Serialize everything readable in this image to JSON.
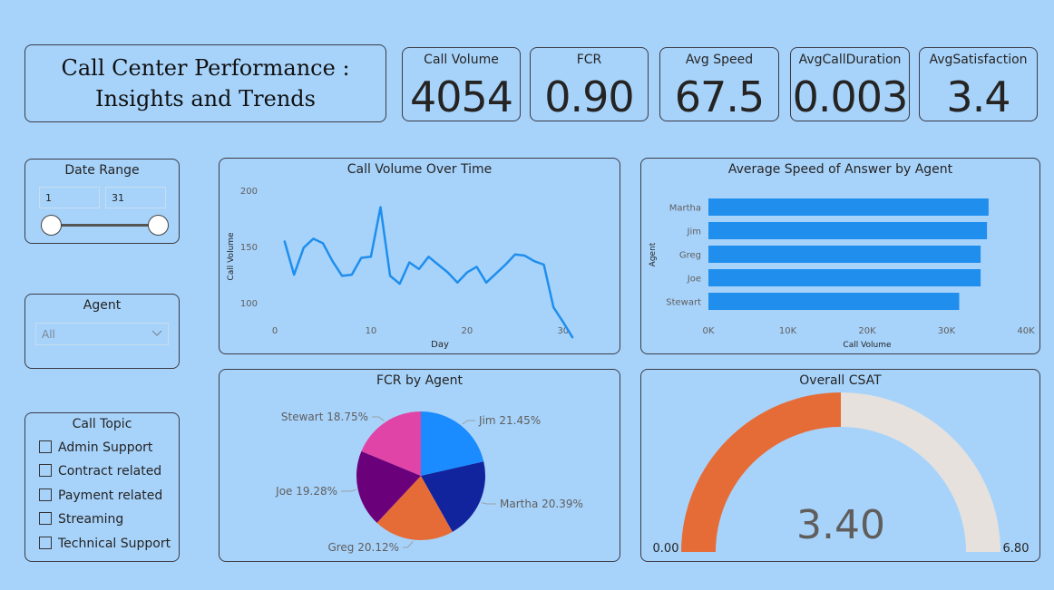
{
  "header": {
    "title_line1": "Call Center Performance :",
    "title_line2": "Insights and Trends"
  },
  "kpis": [
    {
      "label": "Call Volume",
      "value": "4054"
    },
    {
      "label": "FCR",
      "value": "0.90"
    },
    {
      "label": "Avg Speed",
      "value": "67.5"
    },
    {
      "label": "AvgCallDuration",
      "value": "0.003"
    },
    {
      "label": "AvgSatisfaction",
      "value": "3.4"
    }
  ],
  "date_range": {
    "title": "Date Range",
    "start": "1",
    "end": "31"
  },
  "agent_filter": {
    "title": "Agent",
    "selected": "All"
  },
  "call_topic": {
    "title": "Call Topic",
    "options": [
      "Admin Support",
      "Contract related",
      "Payment related",
      "Streaming",
      "Technical Support"
    ]
  },
  "colors": {
    "line": "#1f8eed",
    "bar": "#1f8eed",
    "gauge_fill": "#e66c37",
    "gauge_bg": "#e6e1dc",
    "pie": [
      "#1a8cff",
      "#12239e",
      "#e66c37",
      "#6b007b",
      "#e044a7"
    ]
  },
  "chart_data": [
    {
      "type": "line",
      "title": "Call Volume Over Time",
      "xlabel": "Day",
      "ylabel": "Call Volume",
      "xticks": [
        "0",
        "10",
        "20",
        "30"
      ],
      "yticks": [
        "100",
        "150",
        "200"
      ],
      "xlim": [
        0,
        32
      ],
      "ylim": [
        80,
        200
      ],
      "x": [
        1,
        2,
        3,
        4,
        5,
        6,
        7,
        8,
        9,
        10,
        11,
        12,
        13,
        14,
        15,
        16,
        17,
        18,
        19,
        20,
        21,
        22,
        23,
        24,
        25,
        26,
        27,
        28,
        29,
        30,
        31
      ],
      "values": [
        155,
        125,
        149,
        157,
        153,
        137,
        124,
        125,
        140,
        141,
        185,
        124,
        117,
        136,
        130,
        141,
        134,
        127,
        118,
        127,
        132,
        118,
        126,
        134,
        143,
        142,
        137,
        134,
        96,
        83,
        69
      ],
      "grid": false
    },
    {
      "type": "bar",
      "orientation": "horizontal",
      "title": "Average Speed of Answer by Agent",
      "xlabel": "Call Volume",
      "ylabel": "Agent",
      "categories": [
        "Martha",
        "Jim",
        "Greg",
        "Joe",
        "Stewart"
      ],
      "values": [
        35300,
        35100,
        34300,
        34300,
        31600
      ],
      "xticks": [
        "0K",
        "10K",
        "20K",
        "30K",
        "40K"
      ],
      "xlim": [
        0,
        40000
      ]
    },
    {
      "type": "pie",
      "title": "FCR by Agent",
      "slices": [
        {
          "label": "Jim 21.45%",
          "value": 21.45
        },
        {
          "label": "Martha 20.39%",
          "value": 20.39
        },
        {
          "label": "Greg 20.12%",
          "value": 20.12
        },
        {
          "label": "Joe 19.28%",
          "value": 19.28
        },
        {
          "label": "Stewart 18.75%",
          "value": 18.75
        }
      ]
    },
    {
      "type": "gauge",
      "title": "Overall CSAT",
      "value": 3.4,
      "value_label": "3.40",
      "min_label": "0.00",
      "max_label": "6.80",
      "min": 0,
      "max": 6.8
    }
  ]
}
